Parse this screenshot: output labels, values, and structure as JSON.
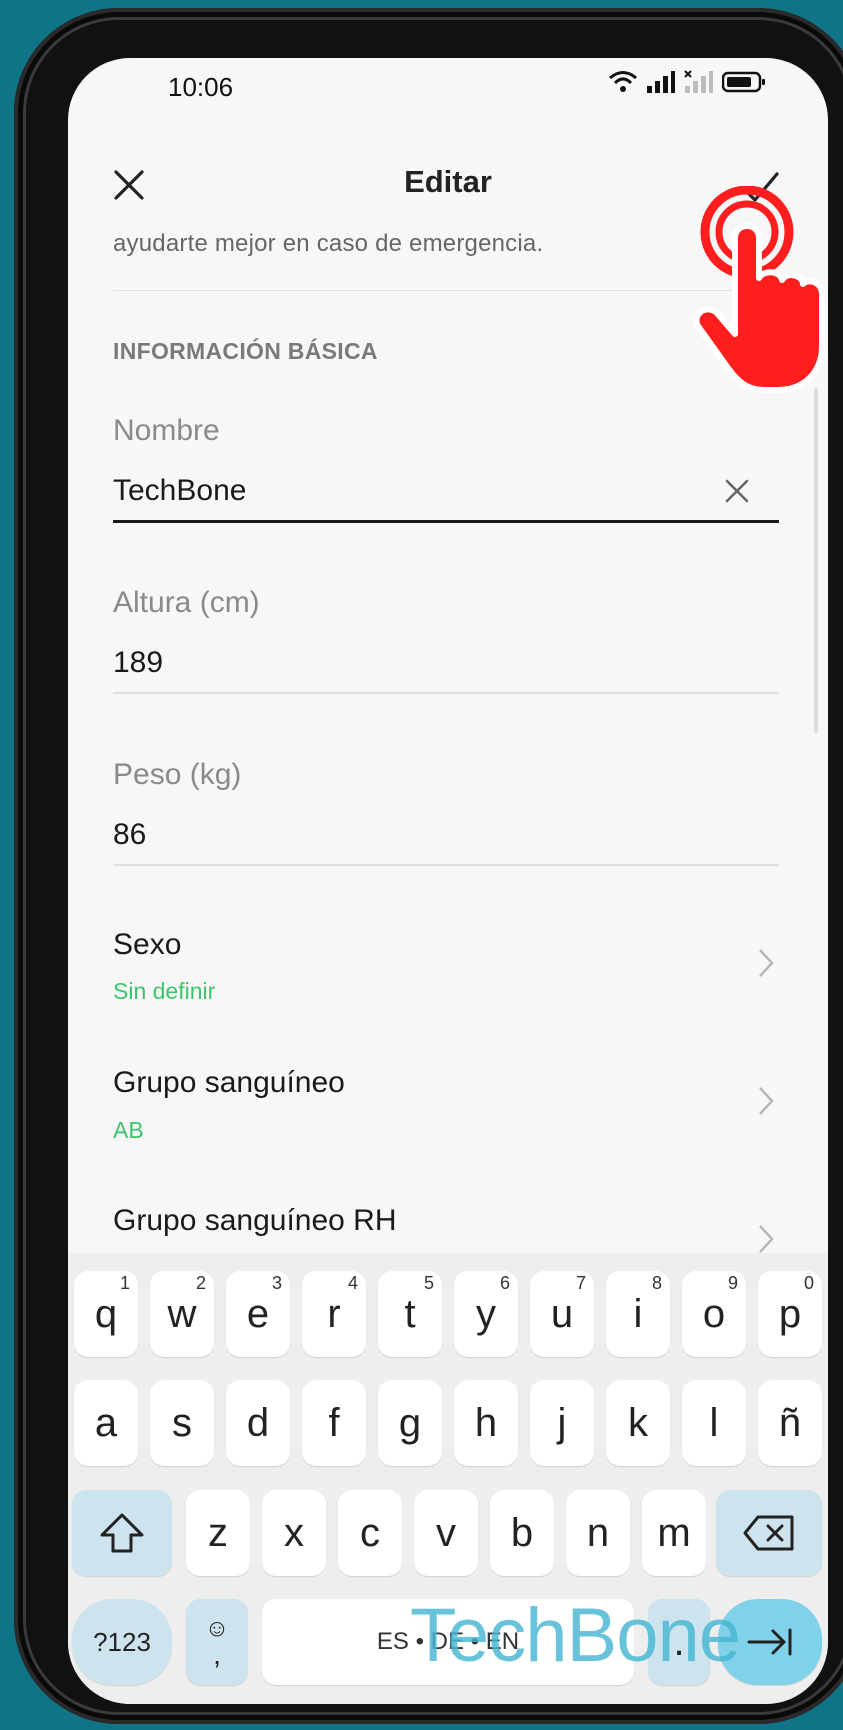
{
  "status_bar": {
    "time": "10:06"
  },
  "header": {
    "title": "Editar"
  },
  "intro_text": "ayudarte mejor en caso de emergencia.",
  "section": {
    "label": "INFORMACIÓN BÁSICA"
  },
  "fields": {
    "name": {
      "label": "Nombre",
      "value": "TechBone"
    },
    "height": {
      "label": "Altura (cm)",
      "value": "189"
    },
    "weight": {
      "label": "Peso (kg)",
      "value": "86"
    }
  },
  "rows": {
    "sex": {
      "title": "Sexo",
      "value": "Sin definir"
    },
    "blood_group": {
      "title": "Grupo sanguíneo",
      "value": "AB"
    },
    "blood_rh": {
      "title": "Grupo sanguíneo RH"
    }
  },
  "keyboard": {
    "row1": [
      {
        "k": "q",
        "h": "1"
      },
      {
        "k": "w",
        "h": "2"
      },
      {
        "k": "e",
        "h": "3"
      },
      {
        "k": "r",
        "h": "4"
      },
      {
        "k": "t",
        "h": "5"
      },
      {
        "k": "y",
        "h": "6"
      },
      {
        "k": "u",
        "h": "7"
      },
      {
        "k": "i",
        "h": "8"
      },
      {
        "k": "o",
        "h": "9"
      },
      {
        "k": "p",
        "h": "0"
      }
    ],
    "row2": [
      "a",
      "s",
      "d",
      "f",
      "g",
      "h",
      "j",
      "k",
      "l",
      "ñ"
    ],
    "row3": [
      "z",
      "x",
      "c",
      "v",
      "b",
      "n",
      "m"
    ],
    "symbols_label": "?123",
    "emoji_key": "☺",
    "comma": ",",
    "space_label": "ES • DE • EN",
    "period": "."
  },
  "watermark": "TechBone",
  "colors": {
    "accent_green": "#3cc56b",
    "tap_red": "#ff1e1e",
    "background": "#0f7586"
  }
}
